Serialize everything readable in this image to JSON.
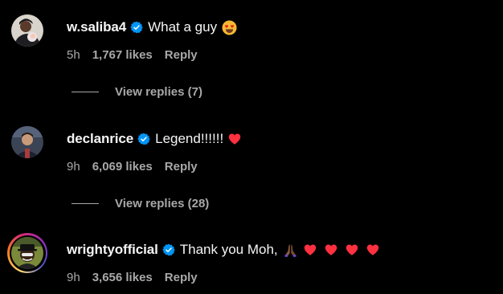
{
  "comments": [
    {
      "username": "w.saliba4",
      "text": "What a guy",
      "emoji": [
        "smiling-face-with-heart-eyes"
      ],
      "time": "5h",
      "likes": "1,767 likes",
      "reply": "Reply",
      "view_replies": "View replies (7)"
    },
    {
      "username": "declanrice",
      "text": "Legend!!!!!!",
      "emoji": [
        "red-heart"
      ],
      "time": "9h",
      "likes": "6,069 likes",
      "reply": "Reply",
      "view_replies": "View replies (28)"
    },
    {
      "username": "wrightyofficial",
      "text": "Thank you Moh,",
      "emoji": [
        "folded-hands",
        "red-heart",
        "red-heart",
        "red-heart",
        "red-heart"
      ],
      "time": "9h",
      "likes": "3,656 likes",
      "reply": "Reply"
    }
  ],
  "colors": {
    "background": "#000000",
    "primary_text": "#f5f5f5",
    "secondary_text": "#a8a8a8",
    "verified_blue": "#0095f6",
    "heart_red": "#ff3040"
  }
}
